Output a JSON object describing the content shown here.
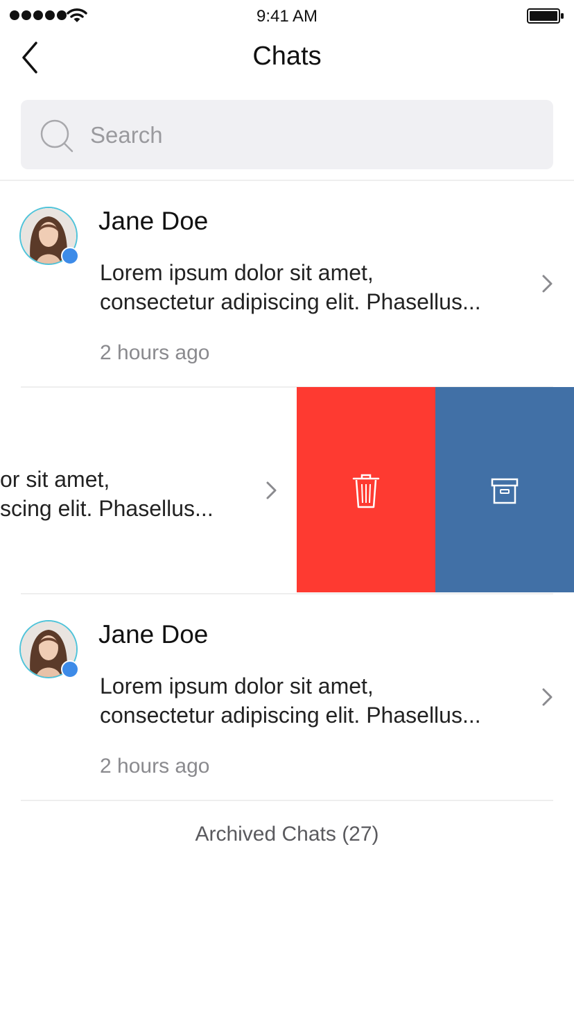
{
  "status_bar": {
    "time": "9:41 AM",
    "signal_icon": "signal-dots-icon",
    "wifi_icon": "wifi-icon",
    "battery_icon": "battery-icon"
  },
  "nav": {
    "title": "Chats",
    "back_icon": "chevron-left-icon"
  },
  "search": {
    "placeholder": "Search",
    "icon": "search-icon"
  },
  "chats": [
    {
      "name": "Jane Doe",
      "message_line1": "Lorem ipsum dolor sit amet,",
      "message_line2": "consectetur adipiscing elit. Phasellus...",
      "time": "2 hours ago",
      "online": true
    },
    {
      "message_line1": "or sit amet,",
      "message_line2": "scing elit. Phasellus...",
      "swiped": true,
      "actions": [
        {
          "name": "delete",
          "icon": "trash-icon",
          "color": "#fe3a31"
        },
        {
          "name": "archive",
          "icon": "archive-box-icon",
          "color": "#4170a6"
        }
      ]
    },
    {
      "name": "Jane Doe",
      "message_line1": "Lorem ipsum dolor sit amet,",
      "message_line2": "consectetur adipiscing elit. Phasellus...",
      "time": "2 hours ago",
      "online": true
    }
  ],
  "archived": {
    "label": "Archived Chats (27)"
  },
  "colors": {
    "delete": "#fe3a31",
    "archive": "#4170a6",
    "online_dot": "#3d8be8",
    "avatar_ring": "#4fc3d9"
  }
}
